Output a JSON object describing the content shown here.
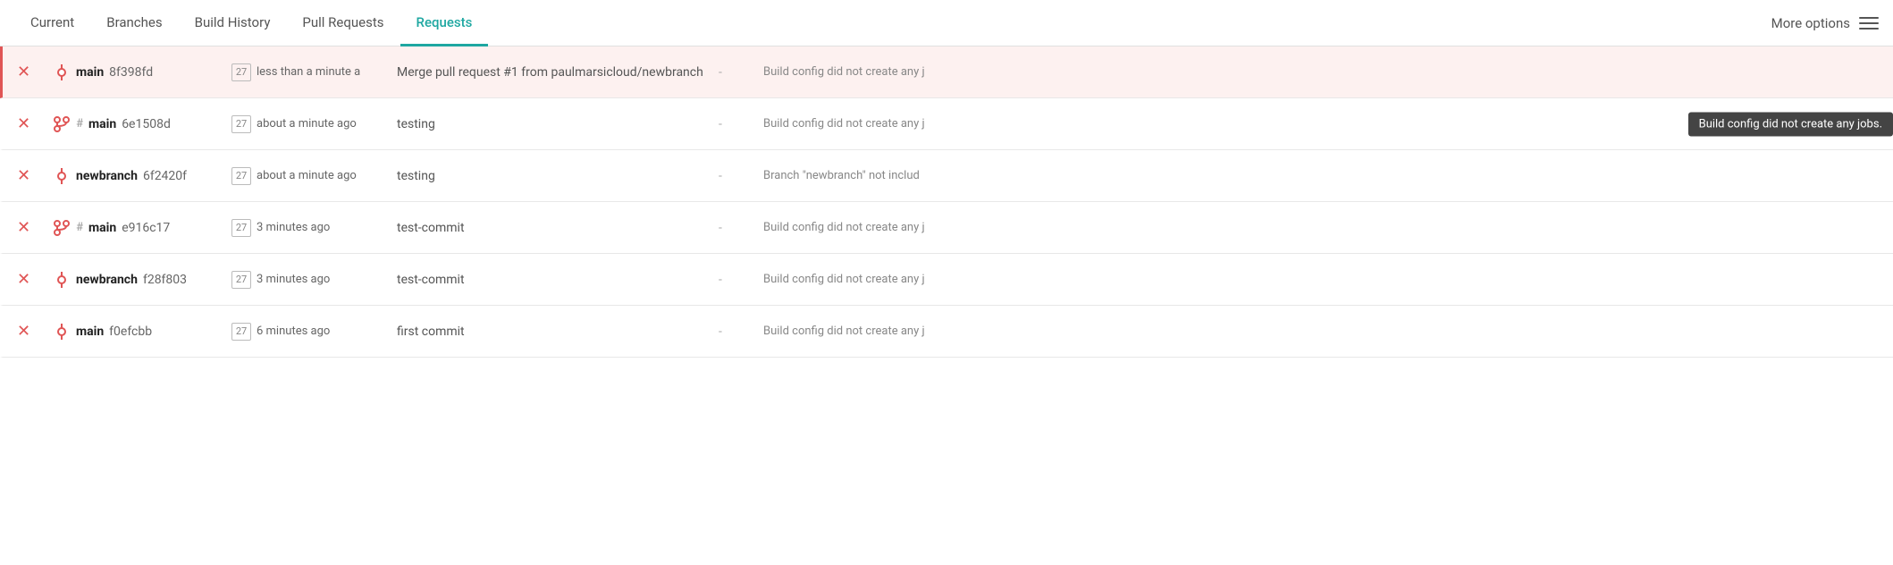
{
  "nav": {
    "tabs": [
      {
        "id": "current",
        "label": "Current",
        "active": false
      },
      {
        "id": "branches",
        "label": "Branches",
        "active": false
      },
      {
        "id": "build-history",
        "label": "Build History",
        "active": false
      },
      {
        "id": "pull-requests",
        "label": "Pull Requests",
        "active": false
      },
      {
        "id": "requests",
        "label": "Requests",
        "active": true
      }
    ],
    "more_options_label": "More options"
  },
  "rows": [
    {
      "id": "row1",
      "highlighted": true,
      "icon_type": "commit",
      "pr_label": "",
      "branch": "main",
      "hash": "8f398fd",
      "time": "less than a minute a",
      "message": "Merge pull request #1 from paulmarsicloud/newbranch",
      "dash": "-",
      "info": "Build config did not create any j",
      "tooltip": "Build config did not create any jobs."
    },
    {
      "id": "row2",
      "highlighted": false,
      "icon_type": "fork",
      "pr_label": "#",
      "branch": "main",
      "hash": "6e1508d",
      "time": "about a minute ago",
      "message": "testing",
      "dash": "-",
      "info": "Build config did not create any j",
      "tooltip": "Build config did not create any jobs."
    },
    {
      "id": "row3",
      "highlighted": false,
      "icon_type": "commit",
      "pr_label": "",
      "branch": "newbranch",
      "hash": "6f2420f",
      "time": "about a minute ago",
      "message": "testing",
      "dash": "-",
      "info": "Branch \"newbranch\" not includ",
      "tooltip": ""
    },
    {
      "id": "row4",
      "highlighted": false,
      "icon_type": "fork",
      "pr_label": "#",
      "branch": "main",
      "hash": "e916c17",
      "time": "3 minutes ago",
      "message": "test-commit",
      "dash": "-",
      "info": "Build config did not create any j",
      "tooltip": ""
    },
    {
      "id": "row5",
      "highlighted": false,
      "icon_type": "commit",
      "pr_label": "",
      "branch": "newbranch",
      "hash": "f28f803",
      "time": "3 minutes ago",
      "message": "test-commit",
      "dash": "-",
      "info": "Build config did not create any j",
      "tooltip": ""
    },
    {
      "id": "row6",
      "highlighted": false,
      "icon_type": "commit",
      "pr_label": "",
      "branch": "main",
      "hash": "f0efcbb",
      "time": "6 minutes ago",
      "message": "first commit",
      "dash": "-",
      "info": "Build config did not create any j",
      "tooltip": ""
    }
  ],
  "calendar_label": "27",
  "icons": {
    "commit_unicode": "⊙",
    "fork_unicode": "⑃",
    "x_unicode": "✕",
    "hamburger": "☰"
  }
}
